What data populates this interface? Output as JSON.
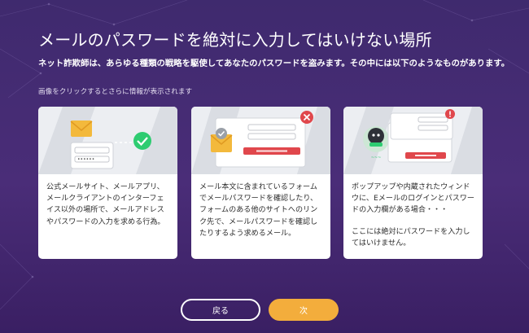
{
  "page": {
    "title": "メールのパスワードを絶対に入力してはいけない場所",
    "description": "ネット詐欺師は、あらゆる種類の戦略を駆使してあなたのパスワードを盗みます。その中には以下のようなものがあります。",
    "hint": "画像をクリックするとさらに情報が表示されます"
  },
  "cards": [
    {
      "icon": "envelope-check-icon",
      "paragraphs": [
        "公式メールサイト、メールアプリ、メールクライアントのインターフェイス以外の場所で、メールアドレスやパスワードの入力を求める行為。"
      ]
    },
    {
      "icon": "email-form-error-icon",
      "paragraphs": [
        "メール本文に含まれているフォームでメールパスワードを確認したり、フォームのある他のサイトへのリンク先で、メールパスワードを確認したりするよう求めるメール。"
      ]
    },
    {
      "icon": "popup-warning-icon",
      "paragraphs": [
        "ポップアップや内蔵されたウィンドウに、Eメールのログインとパスワードの入力欄がある場合・・・",
        "ここには絶対にパスワードを入力してはいけません。"
      ]
    }
  ],
  "buttons": {
    "back": "戻る",
    "next": "次"
  },
  "colors": {
    "accent": "#f3ad3c",
    "danger": "#e0474c",
    "success": "#2ecc71",
    "background": "#42296f"
  }
}
